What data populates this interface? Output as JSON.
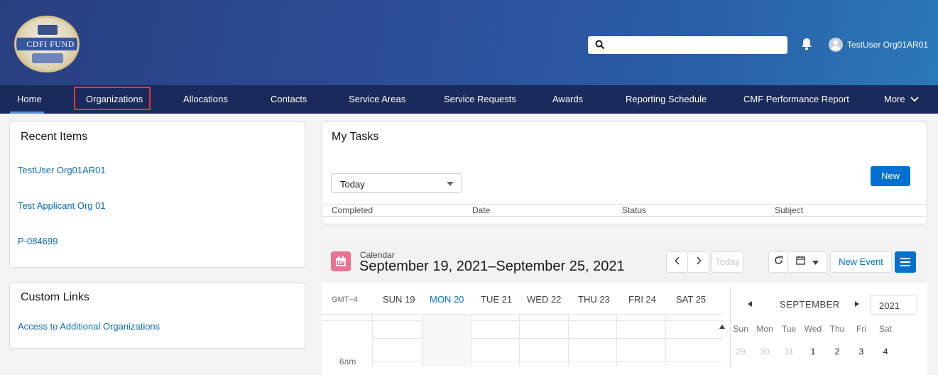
{
  "header": {
    "logo_text": "CDFI FUND",
    "search_placeholder": "",
    "user_name": "TestUser Org01AR01"
  },
  "nav": {
    "items": [
      "Home",
      "Organizations",
      "Allocations",
      "Contacts",
      "Service Areas",
      "Service Requests",
      "Awards",
      "Reporting Schedule",
      "CMF Performance Report",
      "More"
    ],
    "active": "Home",
    "highlighted": "Organizations"
  },
  "recent_items": {
    "title": "Recent Items",
    "items": [
      "TestUser Org01AR01",
      "Test Applicant Org 01",
      "P-084699"
    ]
  },
  "custom_links": {
    "title": "Custom Links",
    "items": [
      "Access to Additional Organizations"
    ]
  },
  "my_tasks": {
    "title": "My Tasks",
    "filter": "Today",
    "new_label": "New",
    "columns": [
      "Completed",
      "Date",
      "Status",
      "Subject"
    ]
  },
  "calendar": {
    "label": "Calendar",
    "range": "September 19, 2021–September 25, 2021",
    "today_label": "Today",
    "new_event_label": "New Event",
    "timezone": "GMT−4",
    "days": [
      "SUN 19",
      "MON 20",
      "TUE 21",
      "WED 22",
      "THU 23",
      "FRI 24",
      "SAT 25"
    ],
    "current_day": "MON 20",
    "time_label": "6am",
    "mini": {
      "month": "SEPTEMBER",
      "year": "2021",
      "dow": [
        "Sun",
        "Mon",
        "Tue",
        "Wed",
        "Thu",
        "Fri",
        "Sat"
      ],
      "first_week": [
        "29",
        "30",
        "31",
        "1",
        "2",
        "3",
        "4"
      ]
    }
  },
  "colors": {
    "nav_bg": "#1a2a5a",
    "link": "#0a6bb7",
    "brand_blue": "#0070d2",
    "highlight_red": "#e5373c",
    "calendar_icon": "#eb7092"
  }
}
